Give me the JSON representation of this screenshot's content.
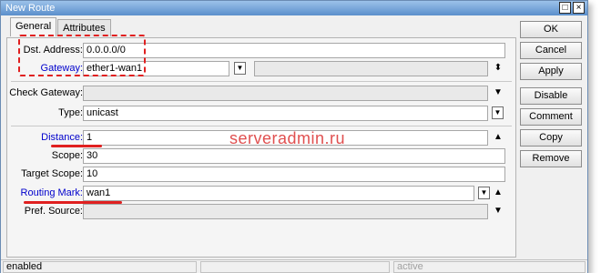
{
  "window": {
    "title": "New Route"
  },
  "title_buttons": {
    "maximize": "□",
    "close": "×"
  },
  "tabs": [
    {
      "label": "General"
    },
    {
      "label": "Attributes"
    }
  ],
  "form": {
    "dst_address": {
      "label": "Dst. Address:",
      "value": "0.0.0.0/0"
    },
    "gateway": {
      "label": "Gateway:",
      "value": "ether1-wan1"
    },
    "check_gateway": {
      "label": "Check Gateway:",
      "value": ""
    },
    "type": {
      "label": "Type:",
      "value": "unicast"
    },
    "distance": {
      "label": "Distance:",
      "value": "1"
    },
    "scope": {
      "label": "Scope:",
      "value": "30"
    },
    "target_scope": {
      "label": "Target Scope:",
      "value": "10"
    },
    "routing_mark": {
      "label": "Routing Mark:",
      "value": "wan1"
    },
    "pref_source": {
      "label": "Pref. Source:",
      "value": ""
    }
  },
  "buttons": {
    "ok": "OK",
    "cancel": "Cancel",
    "apply": "Apply",
    "disable": "Disable",
    "comment": "Comment",
    "copy": "Copy",
    "remove": "Remove"
  },
  "status": {
    "left": "enabled",
    "middle": "",
    "right": "active"
  },
  "watermark": "serveradmin.ru",
  "icons": {
    "dropdown": "▼",
    "spinner": "⬍",
    "arrow_up": "▲",
    "arrow_down": "▼"
  },
  "colors": {
    "accent_label": "#0000cc",
    "annotation": "#e02020"
  }
}
